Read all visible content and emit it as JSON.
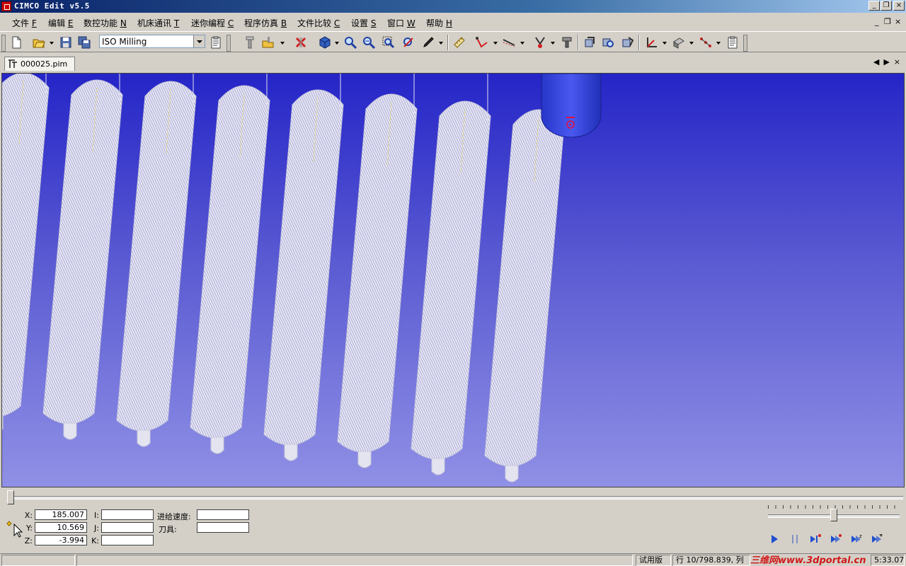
{
  "window": {
    "title": "CIMCO Edit v5.5",
    "min_glyph": "_",
    "restore_glyph": "❐",
    "close_glyph": "×",
    "mdi_min": "_",
    "mdi_restore": "❐",
    "mdi_close": "×"
  },
  "menu": [
    {
      "label": "文件 ",
      "acc": "F"
    },
    {
      "label": "编辑 ",
      "acc": "E"
    },
    {
      "label": "数控功能 ",
      "acc": "N"
    },
    {
      "label": "机床通讯 ",
      "acc": "T"
    },
    {
      "label": "迷你编程 ",
      "acc": "C"
    },
    {
      "label": "程序仿真 ",
      "acc": "B"
    },
    {
      "label": "文件比较 ",
      "acc": "C"
    },
    {
      "label": "设置 ",
      "acc": "S"
    },
    {
      "label": "窗口 ",
      "acc": "W"
    },
    {
      "label": "帮助 ",
      "acc": "H"
    }
  ],
  "toolbar": {
    "machine_type": "ISO Milling",
    "icons": [
      "new-file-icon",
      "open-file-icon",
      "save-icon",
      "save-all-icon",
      "settings-icon",
      "tool-icon",
      "tool-open-icon",
      "delete-tool-icon",
      "solid-view-icon",
      "zoom-in-icon",
      "zoom-out-icon",
      "zoom-window-icon",
      "zoom-fit-icon",
      "pen-icon",
      "ruler-icon",
      "path-icon",
      "path-style-icon",
      "cut-icon",
      "tool-holder-icon",
      "view-rotate-icon",
      "view-pan-icon",
      "view-iso-icon",
      "axis-icon",
      "workpiece-icon",
      "nodes-icon",
      "config-icon"
    ],
    "accent": "#0a246a"
  },
  "document": {
    "tab_label": "000025.pim",
    "nav_prev": "◀",
    "nav_next": "▶",
    "nav_close": "×"
  },
  "viewport": {
    "bg_top": "#2525c8",
    "bg_bottom": "#9090e6",
    "toolpath_color": "#dcdcec",
    "tool_color": "#3a48e0"
  },
  "simulation": {
    "progress": 0.0,
    "speed_level": 0.5,
    "labels": {
      "x": "X:",
      "y": "Y:",
      "z": "Z:",
      "i": "I:",
      "j": "J:",
      "k": "K:",
      "feed": "进给速度:",
      "tool": "刀具:"
    },
    "values": {
      "x": "185.007",
      "y": "10.569",
      "z": "-3.994",
      "i": "",
      "j": "",
      "k": "",
      "feed": "",
      "tool": ""
    },
    "controls": [
      "play-icon",
      "pause-icon",
      "step-icon",
      "step-multi-icon",
      "step-z-icon",
      "step-tool-icon"
    ]
  },
  "status": {
    "pane1": "",
    "pane2": "",
    "trial": "试用版",
    "position": "行 10/798.839, 列",
    "time": "5:33.07"
  },
  "watermark": "三维网www.3dportal.cn"
}
